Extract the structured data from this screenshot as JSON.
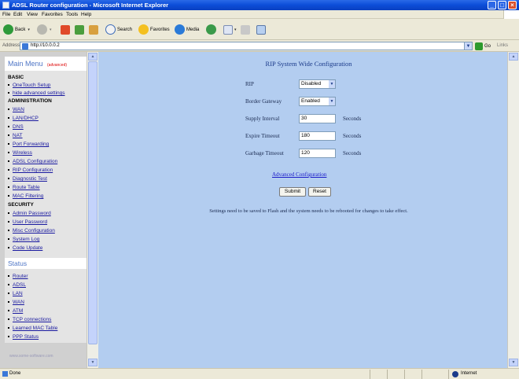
{
  "window": {
    "title": "ADSL Router configuration - Microsoft Internet Explorer"
  },
  "menubar": [
    "File",
    "Edit",
    "View",
    "Favorites",
    "Tools",
    "Help"
  ],
  "toolbar": {
    "back": "Back",
    "search": "Search",
    "favorites": "Favorites",
    "media": "Media"
  },
  "address": {
    "label": "Address",
    "url": "http://10.0.0.2",
    "go": "Go",
    "links": "Links"
  },
  "sidebar": {
    "main_menu": "Main Menu",
    "main_menu_note": "(advanced)",
    "basic_title": "BASIC",
    "basic_items": [
      "OneTouch Setup",
      "hide advanced settings"
    ],
    "admin_title": "ADMINISTRATION",
    "admin_items": [
      "WAN",
      "LAN/DHCP",
      "DNS",
      "NAT",
      "Port Forwarding",
      "Wireless",
      "ADSL Configuration",
      "RIP Configuration",
      "Diagnostic Test",
      "Route Table",
      "MAC Filtering"
    ],
    "security_title": "SECURITY",
    "security_items": [
      "Admin Password",
      "User Password",
      "Misc Configuration",
      "System Log",
      "Code Update"
    ],
    "status_title": "Status",
    "status_items": [
      "Router",
      "ADSL",
      "LAN",
      "WAN",
      "ATM",
      "TCP connections",
      "Learned MAC Table",
      "PPP Status"
    ],
    "cut_text": "www.some-software.com"
  },
  "main": {
    "title": "RIP System Wide Configuration",
    "rip_label": "RIP",
    "rip_value": "Disabled",
    "border_gateway_label": "Border Gateway",
    "border_gateway_value": "Enabled",
    "supply_interval_label": "Supply Interval",
    "supply_interval_value": "30",
    "supply_interval_unit": "Seconds",
    "expire_timeout_label": "Expire Timeout",
    "expire_timeout_value": "180",
    "expire_timeout_unit": "Seconds",
    "garbage_timeout_label": "Garbage Timeout",
    "garbage_timeout_value": "120",
    "garbage_timeout_unit": "Seconds",
    "advanced_link": "Advanced Configuration",
    "submit": "Submit",
    "reset": "Reset",
    "note": "Settings need to be saved to Flash and the system needs to be rebooted for changes to take effect."
  },
  "statusbar": {
    "status": "Done",
    "zone": "Internet"
  }
}
